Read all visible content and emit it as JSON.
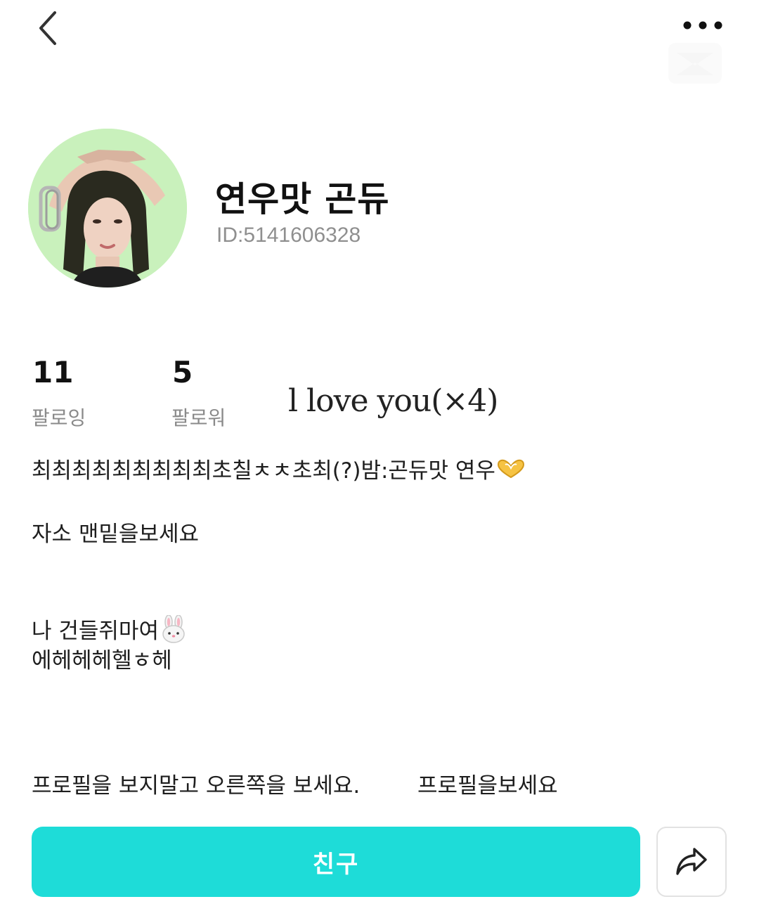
{
  "header": {
    "back_icon": "chevron-left-icon",
    "more_icon": "more-horizontal-icon"
  },
  "profile": {
    "username": "연우맛 곤듀",
    "id_text": "ID:5141606328"
  },
  "stats": {
    "following_count": "11",
    "following_label": "팔로잉",
    "followers_count": "5",
    "followers_label": "팔로워"
  },
  "overlay_text": "l love you(×4)",
  "bio": {
    "line1": "최최최최최최최최최초칠ㅊㅊ초최(?)밤:곤듀맛 연우",
    "line1_emoji": "heart-hands-icon",
    "line2": "자소 맨밑을보세요",
    "line3": "나 건들쥐마여",
    "line3_emoji": "rabbit-face-icon",
    "line4": "에헤헤헤헬ㅎ헤",
    "line5": "프로필을 보지말고 오른쪽을 보세요.",
    "line6": "프로필을보세요"
  },
  "actions": {
    "friend_label": "친구",
    "share_icon": "share-arrow-icon"
  },
  "colors": {
    "accent": "#1edcd8",
    "muted_text": "#8a8a8a",
    "avatar_bg": "#c9f1bc"
  }
}
